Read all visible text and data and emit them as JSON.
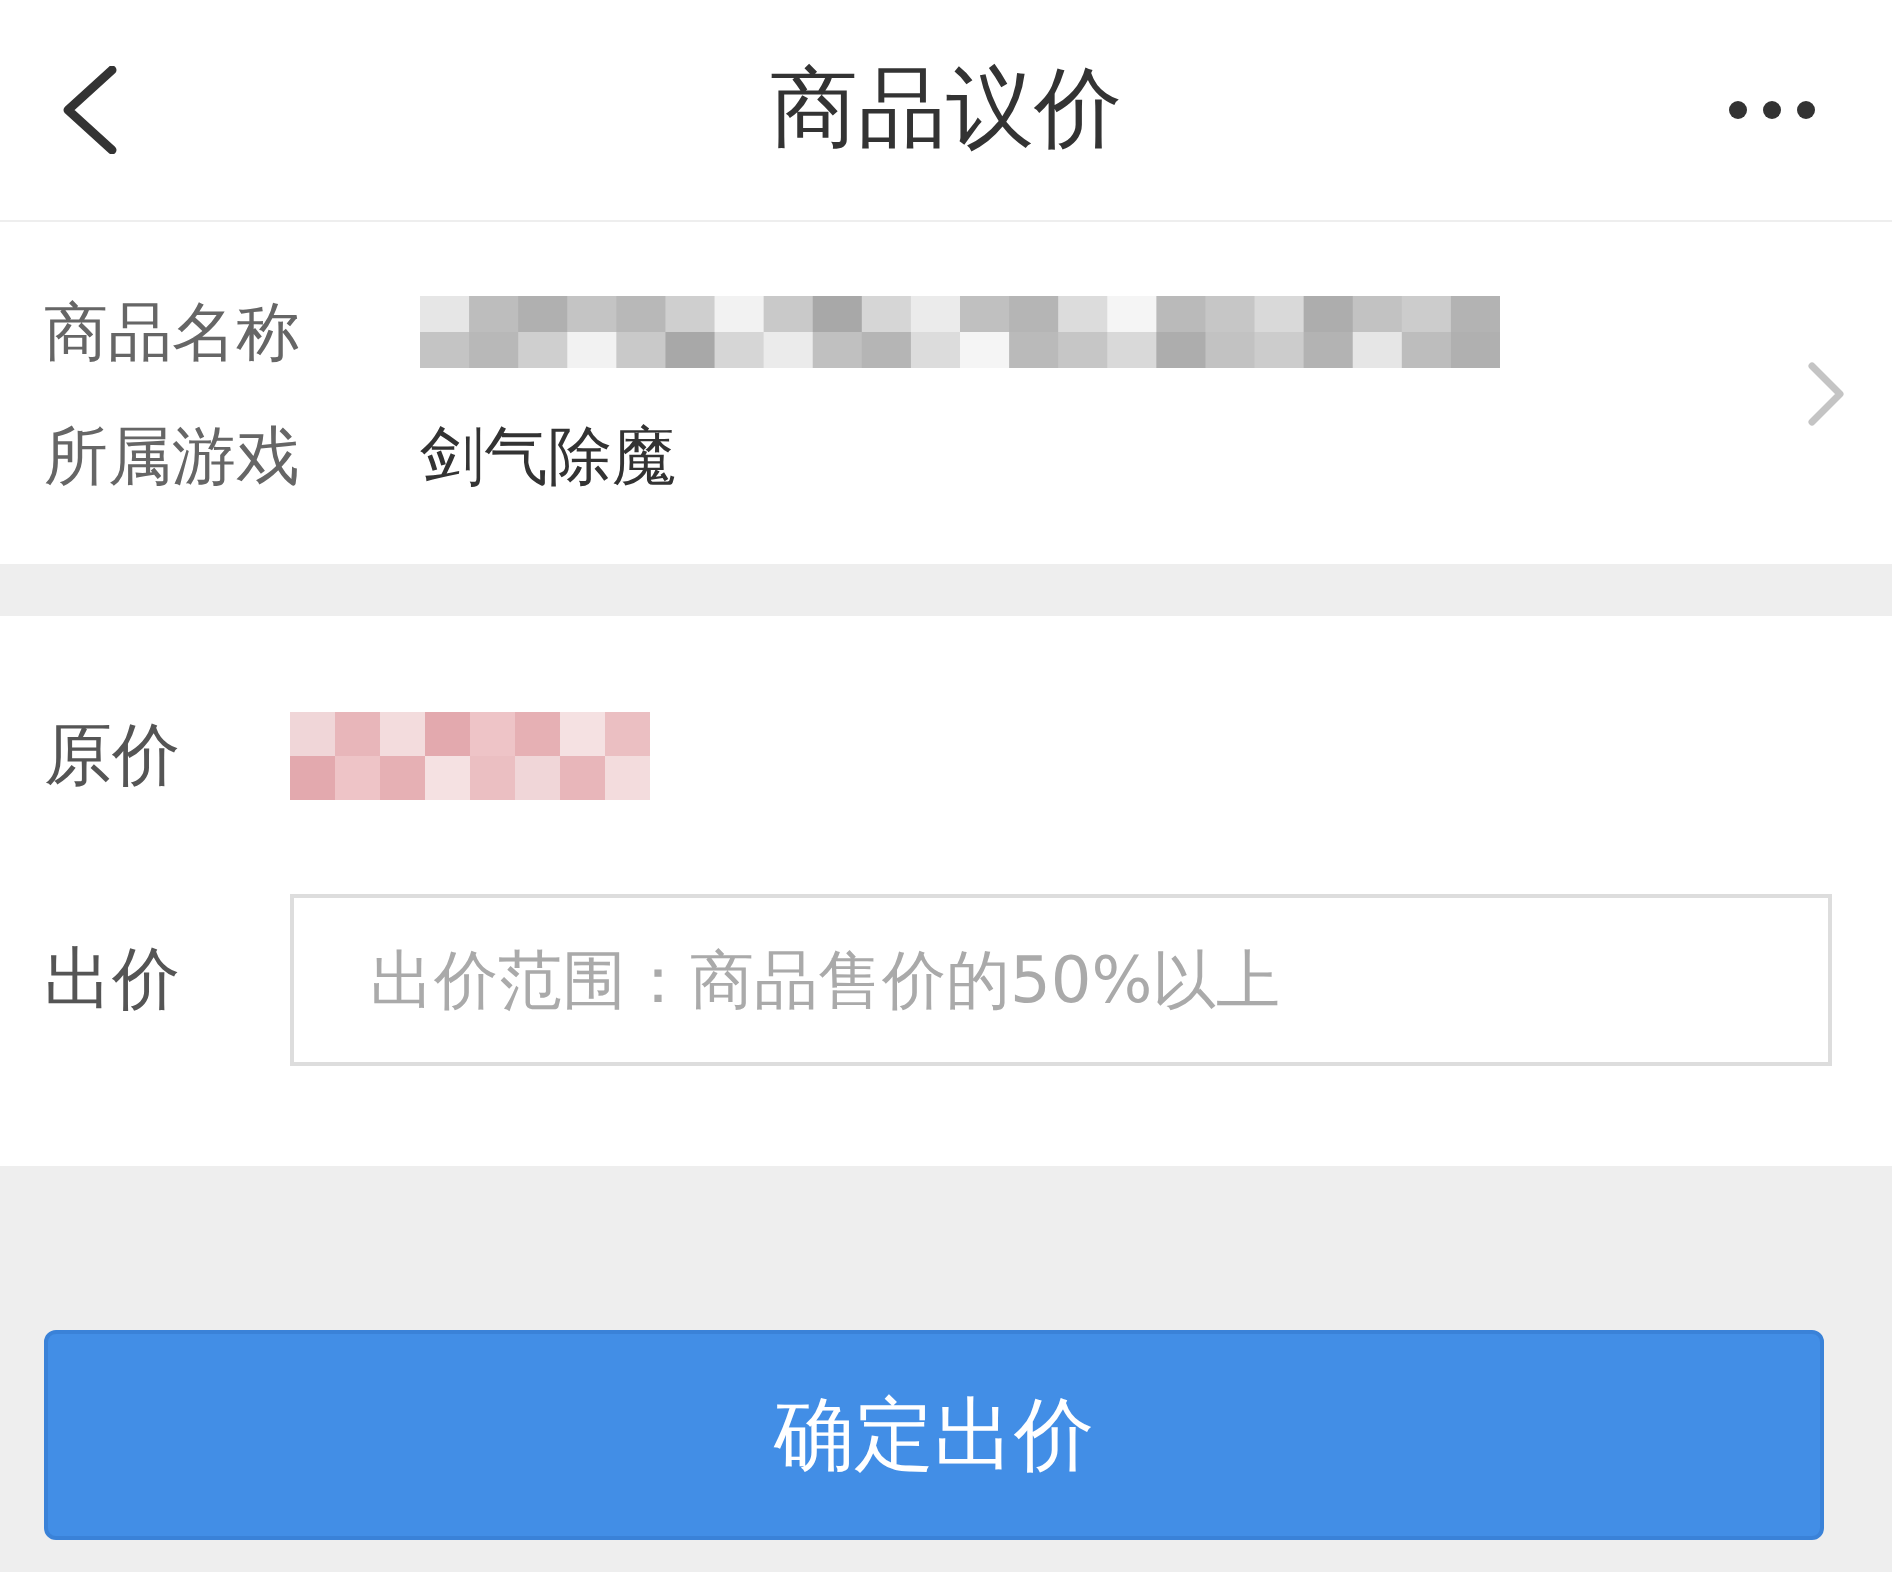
{
  "header": {
    "title": "商品议价"
  },
  "product": {
    "rows": [
      {
        "kind": "blurred",
        "label": "商品名称"
      },
      {
        "kind": "text",
        "label": "所属游戏",
        "value": "剑气除魔"
      }
    ]
  },
  "offer": {
    "rows": [
      {
        "kind": "price",
        "label": "原价"
      },
      {
        "kind": "input",
        "label": "出价",
        "placeholder": "出价范围：商品售价的50%以上"
      }
    ]
  },
  "submit_button": {
    "label": "确定出价"
  }
}
